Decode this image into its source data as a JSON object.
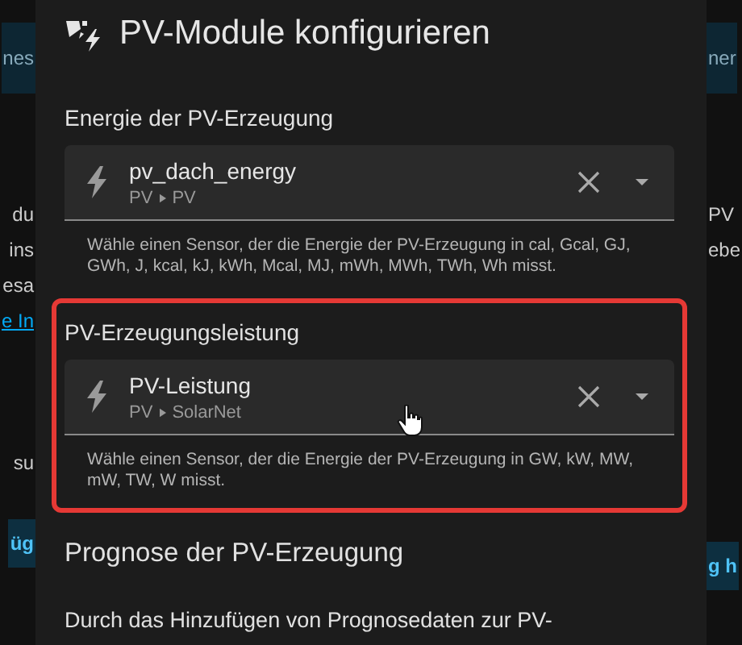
{
  "background_left": [
    {
      "kind": "banner",
      "text": "nes"
    },
    {
      "kind": "text",
      "text": "du"
    },
    {
      "kind": "text",
      "text": "ins"
    },
    {
      "kind": "text",
      "text": "esa"
    },
    {
      "kind": "link",
      "text": "e In"
    },
    {
      "kind": "text",
      "text": "su"
    },
    {
      "kind": "button",
      "text": "üg"
    }
  ],
  "background_right": [
    {
      "kind": "banner",
      "text": "ner"
    },
    {
      "kind": "text",
      "text": "PV"
    },
    {
      "kind": "text",
      "text": "ebe"
    },
    {
      "kind": "button",
      "text": "g h"
    }
  ],
  "dialog": {
    "title": "PV-Module konfigurieren",
    "sections": [
      {
        "heading": "Energie der PV-Erzeugung",
        "highlighted": false,
        "field": {
          "value": "pv_dach_energy",
          "area": "PV",
          "device": "PV"
        },
        "helper": "Wähle einen Sensor, der die Energie der PV-Erzeugung in cal, Gcal, GJ, GWh, J, kcal, kJ, kWh, Mcal, MJ, mWh, MWh, TWh, Wh misst."
      },
      {
        "heading": "PV-Erzeugungsleistung",
        "highlighted": true,
        "field": {
          "value": "PV-Leistung",
          "area": "PV",
          "device": "SolarNet"
        },
        "helper": "Wähle einen Sensor, der die Energie der PV-Erzeugung in GW, kW, MW, mW, TW, W misst."
      }
    ],
    "forecast_heading": "Prognose der PV-Erzeugung",
    "forecast_text": "Durch das Hinzufügen von Prognosedaten zur PV-"
  }
}
